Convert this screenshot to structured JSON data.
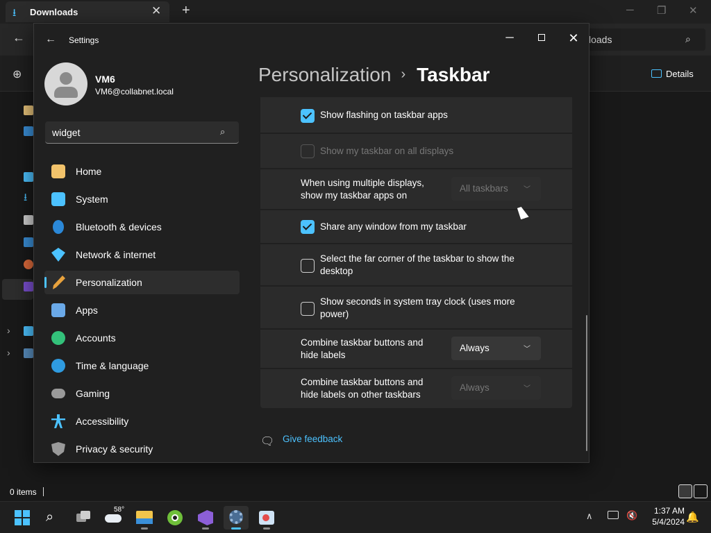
{
  "explorer": {
    "tab_title": "Downloads",
    "tab_close": "✕",
    "new_tab": "+",
    "minimize": "─",
    "restore": "❐",
    "close": "✕",
    "back": "←",
    "search_visible_text": "loads",
    "toolbar_new": "⊕",
    "details_label": "Details",
    "status_items": "0 items",
    "nav_icons": [
      "home-icon",
      "gallery-icon",
      "desktop-icon",
      "downloads-icon",
      "documents-icon",
      "pictures-icon",
      "music-icon",
      "videos-icon",
      "this-pc-icon",
      "network-icon"
    ]
  },
  "settings": {
    "app_title": "Settings",
    "back": "←",
    "window_buttons": {
      "minimize": "─",
      "close": "✕"
    },
    "user": {
      "name": "VM6",
      "email": "VM6@collabnet.local"
    },
    "search": {
      "value": "widget",
      "icon": "search-icon"
    },
    "nav": [
      {
        "label": "Home",
        "icon": "home-icon",
        "color": "#f2c36b"
      },
      {
        "label": "System",
        "icon": "system-icon",
        "color": "#4cc2ff"
      },
      {
        "label": "Bluetooth & devices",
        "icon": "bluetooth-icon",
        "color": "#2b88d8"
      },
      {
        "label": "Network & internet",
        "icon": "network-icon",
        "color": "#4cc2ff"
      },
      {
        "label": "Personalization",
        "icon": "brush-icon",
        "color": "#e8a23d",
        "selected": true
      },
      {
        "label": "Apps",
        "icon": "apps-icon",
        "color": "#6aa9e8"
      },
      {
        "label": "Accounts",
        "icon": "accounts-icon",
        "color": "#33c17a"
      },
      {
        "label": "Time & language",
        "icon": "time-language-icon",
        "color": "#2f9be0"
      },
      {
        "label": "Gaming",
        "icon": "gaming-icon",
        "color": "#9a9a9a"
      },
      {
        "label": "Accessibility",
        "icon": "accessibility-icon",
        "color": "#4cc2ff"
      },
      {
        "label": "Privacy & security",
        "icon": "shield-icon",
        "color": "#9a9a9a"
      }
    ],
    "breadcrumb": {
      "parent": "Personalization",
      "separator": "›",
      "current": "Taskbar"
    },
    "rows": [
      {
        "type": "checkbox",
        "label": "Show flashing on taskbar apps",
        "checked": true,
        "enabled": true
      },
      {
        "type": "checkbox",
        "label": "Show my taskbar on all displays",
        "checked": false,
        "enabled": false
      },
      {
        "type": "dropdown",
        "label": "When using multiple displays, show my taskbar apps on",
        "value": "All taskbars",
        "enabled": false
      },
      {
        "type": "checkbox",
        "label": "Share any window from my taskbar",
        "checked": true,
        "enabled": true
      },
      {
        "type": "checkbox",
        "label": "Select the far corner of the taskbar to show the desktop",
        "checked": false,
        "enabled": true
      },
      {
        "type": "checkbox",
        "label": "Show seconds in system tray clock (uses more power)",
        "checked": false,
        "enabled": true
      },
      {
        "type": "dropdown",
        "label": "Combine taskbar buttons and hide labels",
        "value": "Always",
        "enabled": true
      },
      {
        "type": "dropdown",
        "label": "Combine taskbar buttons and hide labels on other taskbars",
        "value": "Always",
        "enabled": false
      }
    ],
    "feedback": "Give feedback"
  },
  "taskbar": {
    "weather_temp": "58°",
    "apps": [
      "start-icon",
      "search-icon",
      "task-view-icon",
      "weather-icon",
      "file-explorer-icon",
      "green-app-icon",
      "visual-studio-icon",
      "settings-icon",
      "paint-icon"
    ],
    "tray_chevron": "∧",
    "time": "1:37 AM",
    "date": "5/4/2024"
  },
  "colors": {
    "accent": "#4cc2ff",
    "window_bg": "#202020",
    "card_bg": "#2b2b2b"
  }
}
